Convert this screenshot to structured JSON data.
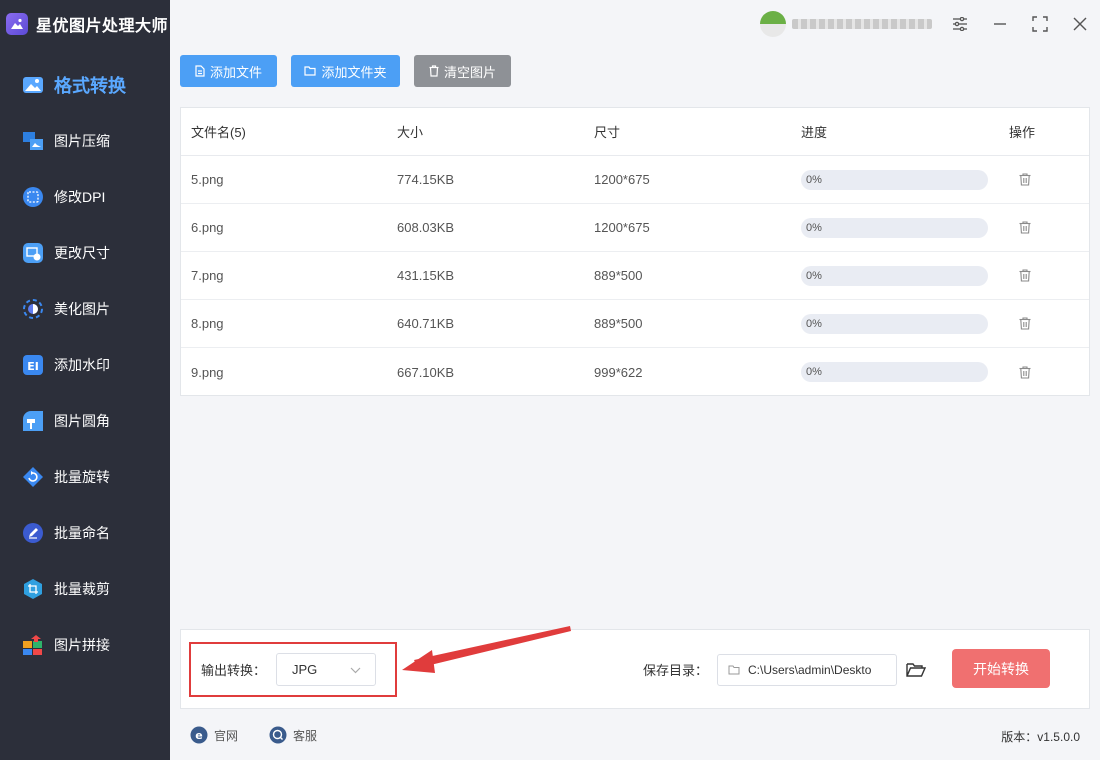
{
  "app": {
    "title": "星优图片处理大师"
  },
  "sidebar": {
    "items": [
      {
        "label": "格式转换",
        "icon": "image-convert-icon",
        "active": true
      },
      {
        "label": "图片压缩",
        "icon": "compress-icon"
      },
      {
        "label": "修改DPI",
        "icon": "dpi-icon"
      },
      {
        "label": "更改尺寸",
        "icon": "resize-icon"
      },
      {
        "label": "美化图片",
        "icon": "beautify-icon"
      },
      {
        "label": "添加水印",
        "icon": "watermark-icon"
      },
      {
        "label": "图片圆角",
        "icon": "round-corner-icon"
      },
      {
        "label": "批量旋转",
        "icon": "rotate-icon"
      },
      {
        "label": "批量命名",
        "icon": "rename-icon"
      },
      {
        "label": "批量裁剪",
        "icon": "crop-icon"
      },
      {
        "label": "图片拼接",
        "icon": "stitch-icon"
      }
    ]
  },
  "toolbar": {
    "add_file": "添加文件",
    "add_folder": "添加文件夹",
    "clear": "清空图片",
    "colors": {
      "primary": "#4c9ff5",
      "gray": "#8e9196"
    }
  },
  "table": {
    "headers": {
      "name": "文件名(5)",
      "size": "大小",
      "dims": "尺寸",
      "progress": "进度",
      "action": "操作"
    },
    "rows": [
      {
        "name": "5.png",
        "size": "774.15KB",
        "dims": "1200*675",
        "progress_label": "0%",
        "progress": 0
      },
      {
        "name": "6.png",
        "size": "608.03KB",
        "dims": "1200*675",
        "progress_label": "0%",
        "progress": 0
      },
      {
        "name": "7.png",
        "size": "431.15KB",
        "dims": "889*500",
        "progress_label": "0%",
        "progress": 0
      },
      {
        "name": "8.png",
        "size": "640.71KB",
        "dims": "889*500",
        "progress_label": "0%",
        "progress": 0
      },
      {
        "name": "9.png",
        "size": "667.10KB",
        "dims": "999*622",
        "progress_label": "0%",
        "progress": 0
      }
    ]
  },
  "bottom": {
    "output_label": "输出转换：",
    "output_format": "JPG",
    "save_label": "保存目录：",
    "save_path": "C:\\Users\\admin\\Deskto",
    "start_label": "开始转换",
    "highlight_color": "#e03c3c"
  },
  "footer": {
    "site": "官网",
    "support": "客服",
    "version": "版本：v1.5.0.0"
  }
}
